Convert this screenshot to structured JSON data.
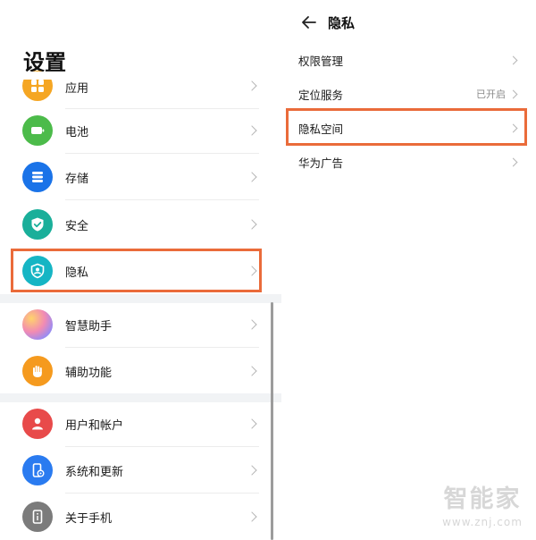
{
  "left_panel": {
    "title": "设置",
    "items": [
      {
        "label": "应用",
        "icon": "apps-icon",
        "color": "#f5a623"
      },
      {
        "label": "电池",
        "icon": "battery-icon",
        "color": "#4cbb4a"
      },
      {
        "label": "存储",
        "icon": "storage-icon",
        "color": "#1a73e8"
      },
      {
        "label": "安全",
        "icon": "shield-check-icon",
        "color": "#1aaf9a"
      },
      {
        "label": "隐私",
        "icon": "privacy-shield-icon",
        "color": "#16b5c4"
      },
      {
        "label": "智慧助手",
        "icon": "smart-assistant-icon",
        "color": "#c78be8"
      },
      {
        "label": "辅助功能",
        "icon": "hand-icon",
        "color": "#f59a1e"
      },
      {
        "label": "用户和帐户",
        "icon": "user-icon",
        "color": "#e84a4a"
      },
      {
        "label": "系统和更新",
        "icon": "system-update-icon",
        "color": "#2a7bf0"
      },
      {
        "label": "关于手机",
        "icon": "phone-info-icon",
        "color": "#7b7b7b"
      }
    ]
  },
  "right_panel": {
    "title": "隐私",
    "items": [
      {
        "label": "权限管理",
        "value": ""
      },
      {
        "label": "定位服务",
        "value": "已开启"
      },
      {
        "label": "隐私空间",
        "value": ""
      },
      {
        "label": "华为广告",
        "value": ""
      }
    ]
  },
  "highlight_color": "#ea6b3a",
  "watermark": {
    "text": "智能家",
    "url": "www.znj.com"
  }
}
